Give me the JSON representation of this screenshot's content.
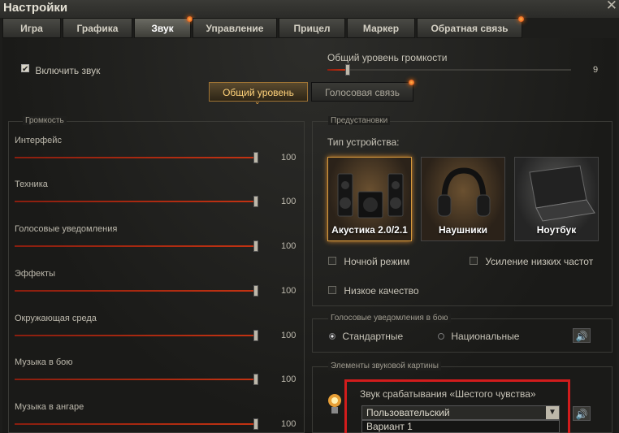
{
  "window": {
    "title": "Настройки",
    "close_label": "✕"
  },
  "tabs": [
    {
      "label": "Игра",
      "active": false
    },
    {
      "label": "Графика",
      "active": false
    },
    {
      "label": "Звук",
      "active": true,
      "badge": true
    },
    {
      "label": "Управление",
      "active": false
    },
    {
      "label": "Прицел",
      "active": false
    },
    {
      "label": "Маркер",
      "active": false
    },
    {
      "label": "Обратная связь",
      "active": false,
      "badge": true
    }
  ],
  "sound": {
    "enable_label": "Включить звук",
    "enable_checked": true,
    "master_label": "Общий уровень громкости",
    "master_value": "9",
    "subtabs": [
      {
        "label": "Общий уровень",
        "active": true
      },
      {
        "label": "Голосовая связь",
        "active": false,
        "badge": true
      }
    ]
  },
  "volume": {
    "legend": "Громкость",
    "items": [
      {
        "label": "Интерфейс",
        "value": "100"
      },
      {
        "label": "Техника",
        "value": "100"
      },
      {
        "label": "Голосовые уведомления",
        "value": "100"
      },
      {
        "label": "Эффекты",
        "value": "100"
      },
      {
        "label": "Окружающая среда",
        "value": "100"
      },
      {
        "label": "Музыка в бою",
        "value": "100"
      },
      {
        "label": "Музыка в ангаре",
        "value": "100"
      }
    ]
  },
  "presets": {
    "legend": "Предустановки",
    "device_type_label": "Тип устройства:",
    "devices": [
      {
        "label": "Акустика 2.0/2.1",
        "selected": true,
        "icon": "speakers-icon"
      },
      {
        "label": "Наушники",
        "selected": false,
        "icon": "headphones-icon"
      },
      {
        "label": "Ноутбук",
        "selected": false,
        "icon": "laptop-icon"
      }
    ],
    "night_mode_label": "Ночной режим",
    "bass_boost_label": "Усиление низких частот",
    "low_quality_label": "Низкое качество"
  },
  "voice_notifications": {
    "legend": "Голосовые уведомления в бою",
    "option_standard": "Стандартные",
    "option_national": "Национальные",
    "selected": "standard"
  },
  "sound_elements": {
    "legend": "Элементы звуковой картины",
    "sixth_sense_label": "Звук срабатывания «Шестого чувства»",
    "dropdown_value": "Пользовательский",
    "dropdown_option": "Вариант 1",
    "highlight_color": "#d21c1c"
  },
  "colors": {
    "accent": "#d79a3e",
    "slider_fill": "#c43312"
  }
}
